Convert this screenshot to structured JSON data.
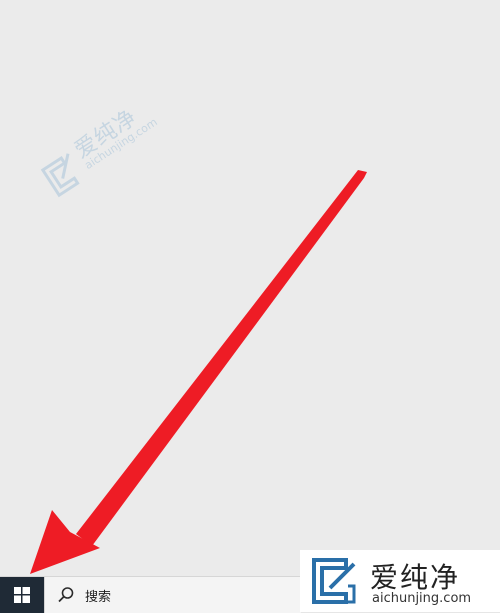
{
  "watermark": {
    "cn": "爱纯净",
    "en": "aichunjing.com",
    "color": "#6aa0c8"
  },
  "annotation": {
    "arrow_color": "#ee1c25",
    "points_to": "start-button"
  },
  "taskbar": {
    "start_icon": "windows-logo-icon",
    "search": {
      "icon": "search-icon",
      "label": "搜索"
    },
    "background": "#e6e6e6",
    "start_background": "#1f2a36"
  },
  "brand": {
    "cn": "爱纯净",
    "en": "aichunjing.com",
    "logo_color": "#2a6fa8"
  }
}
